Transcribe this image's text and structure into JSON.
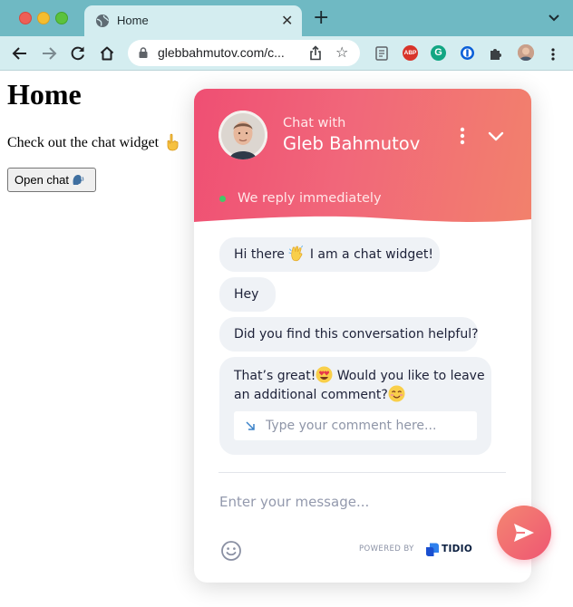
{
  "browser": {
    "tab": {
      "title": "Home",
      "close_glyph": "✕"
    },
    "new_tab_glyph": "+",
    "address": {
      "url": "glebbahmutov.com/c..."
    },
    "extensions": {
      "abp_label": "ABP",
      "grammarly_label": "G"
    }
  },
  "page": {
    "heading": "Home",
    "intro": "Check out the chat widget",
    "open_chat_label": "Open chat"
  },
  "chat": {
    "header": {
      "subtitle": "Chat with",
      "agent_name": "Gleb Bahmutov",
      "status": "We reply immediately"
    },
    "messages": [
      {
        "before": "Hi there",
        "emoji": "waving-hand",
        "after": "I am a chat widget!"
      },
      {
        "text": "Hey"
      },
      {
        "text": "Did you find this conversation helpful?"
      },
      {
        "line1": "That’s great!",
        "line1_after": "Would you like to leave",
        "line2": "an additional comment?"
      }
    ],
    "comment_placeholder": "Type your comment here...",
    "message_placeholder": "Enter your message...",
    "powered_by": "POWERED BY",
    "brand": "TIDIO"
  },
  "colors": {
    "tabbar": "#6fb9c3",
    "toolbar": "#d4edf0",
    "header_gradient_start": "#ef4f73",
    "header_gradient_end": "#f2816c",
    "bubble": "#eff2f6",
    "online": "#44c767"
  },
  "icons": {
    "tab": "globe-icon",
    "nav": [
      "back-arrow-icon",
      "forward-arrow-icon",
      "reload-icon",
      "home-icon"
    ],
    "omnibox": [
      "lock-icon",
      "share-icon",
      "star-icon"
    ],
    "chat": [
      "kebab-menu-icon",
      "chevron-down-icon",
      "online-dot-icon",
      "emoji-icon",
      "send-icon"
    ]
  }
}
